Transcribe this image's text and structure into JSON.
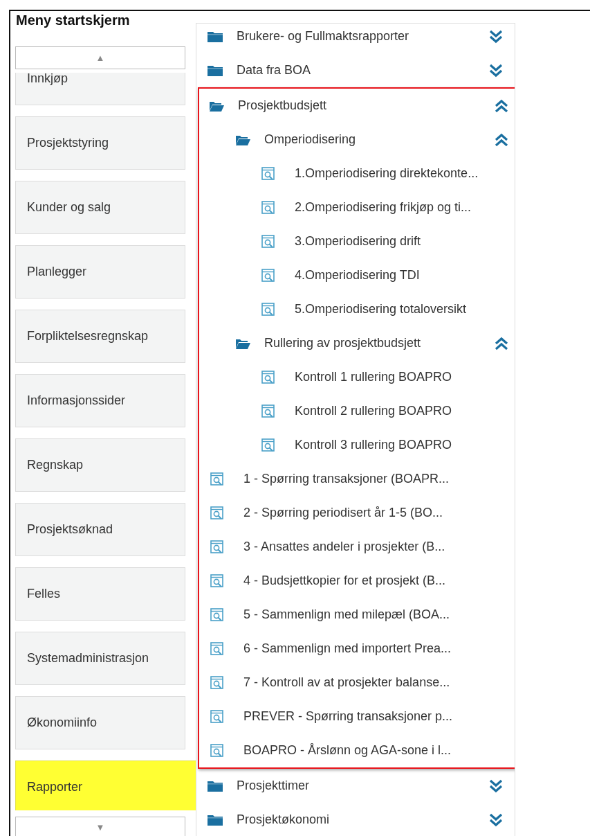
{
  "title": "Meny startskjerm",
  "sidebar": {
    "scroll_up": "▲",
    "scroll_down": "▼",
    "items": [
      {
        "label": "Innkjøp",
        "selected": false
      },
      {
        "label": "Prosjektstyring",
        "selected": false
      },
      {
        "label": "Kunder og salg",
        "selected": false
      },
      {
        "label": "Planlegger",
        "selected": false
      },
      {
        "label": "Forpliktelsesregnskap",
        "selected": false
      },
      {
        "label": "Informasjonssider",
        "selected": false
      },
      {
        "label": "Regnskap",
        "selected": false
      },
      {
        "label": "Prosjektsøknad",
        "selected": false
      },
      {
        "label": "Felles",
        "selected": false
      },
      {
        "label": "Systemadministrasjon",
        "selected": false
      },
      {
        "label": "Økonomiinfo",
        "selected": false
      },
      {
        "label": "Rapporter",
        "selected": true
      }
    ]
  },
  "tree": [
    {
      "kind": "folder",
      "label": "Brukere- og Fullmaktsrapporter",
      "expanded": false,
      "highlighted": false
    },
    {
      "kind": "folder",
      "label": "Data fra BOA",
      "expanded": false,
      "highlighted": false
    },
    {
      "kind": "folder",
      "label": "Prosjektbudsjett",
      "expanded": true,
      "highlighted": true,
      "children": [
        {
          "kind": "folder",
          "label": "Omperiodisering",
          "expanded": true,
          "highlighted": false,
          "children": [
            {
              "kind": "report",
              "label": "1.Omperiodisering direktekonte..."
            },
            {
              "kind": "report",
              "label": "2.Omperiodisering frikjøp og ti..."
            },
            {
              "kind": "report",
              "label": "3.Omperiodisering drift"
            },
            {
              "kind": "report",
              "label": "4.Omperiodisering TDI"
            },
            {
              "kind": "report",
              "label": "5.Omperiodisering totaloversikt"
            }
          ]
        },
        {
          "kind": "folder",
          "label": "Rullering av prosjektbudsjett",
          "expanded": true,
          "highlighted": false,
          "children": [
            {
              "kind": "report",
              "label": "Kontroll 1 rullering BOAPRO"
            },
            {
              "kind": "report",
              "label": "Kontroll 2 rullering BOAPRO"
            },
            {
              "kind": "report",
              "label": "Kontroll 3 rullering BOAPRO"
            }
          ]
        },
        {
          "kind": "report",
          "label": "1 - Spørring transaksjoner (BOAPR..."
        },
        {
          "kind": "report",
          "label": "2 - Spørring periodisert år 1-5 (BO..."
        },
        {
          "kind": "report",
          "label": "3 - Ansattes andeler i prosjekter (B..."
        },
        {
          "kind": "report",
          "label": "4 - Budsjettkopier for et prosjekt (B..."
        },
        {
          "kind": "report",
          "label": "5 - Sammenlign med milepæl (BOA..."
        },
        {
          "kind": "report",
          "label": "6 - Sammenlign med importert Prea..."
        },
        {
          "kind": "report",
          "label": "7 - Kontroll av at prosjekter balanse..."
        },
        {
          "kind": "report",
          "label": "PREVER - Spørring transaksjoner p..."
        },
        {
          "kind": "report",
          "label": "BOAPRO - Årslønn og AGA-sone i l..."
        }
      ]
    },
    {
      "kind": "folder",
      "label": "Prosjekttimer",
      "expanded": false,
      "highlighted": false
    },
    {
      "kind": "folder",
      "label": "Prosjektøkonomi",
      "expanded": false,
      "highlighted": false
    }
  ]
}
